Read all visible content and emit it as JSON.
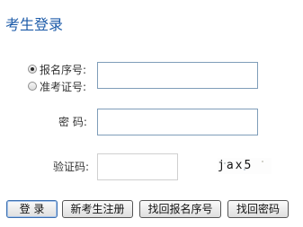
{
  "page_title": "考生登录",
  "id_type": {
    "options": [
      {
        "label": "报名序号:",
        "selected": true
      },
      {
        "label": "准考证号:",
        "selected": false
      }
    ]
  },
  "fields": {
    "id_value": "",
    "password_label": "密 码:",
    "password_value": "",
    "captcha_label": "验证码:",
    "captcha_value": "",
    "captcha_image_text": "jax5"
  },
  "buttons": {
    "login": "登  录",
    "register": "新考生注册",
    "recover_id": "找回报名序号",
    "recover_password": "找回密码"
  }
}
